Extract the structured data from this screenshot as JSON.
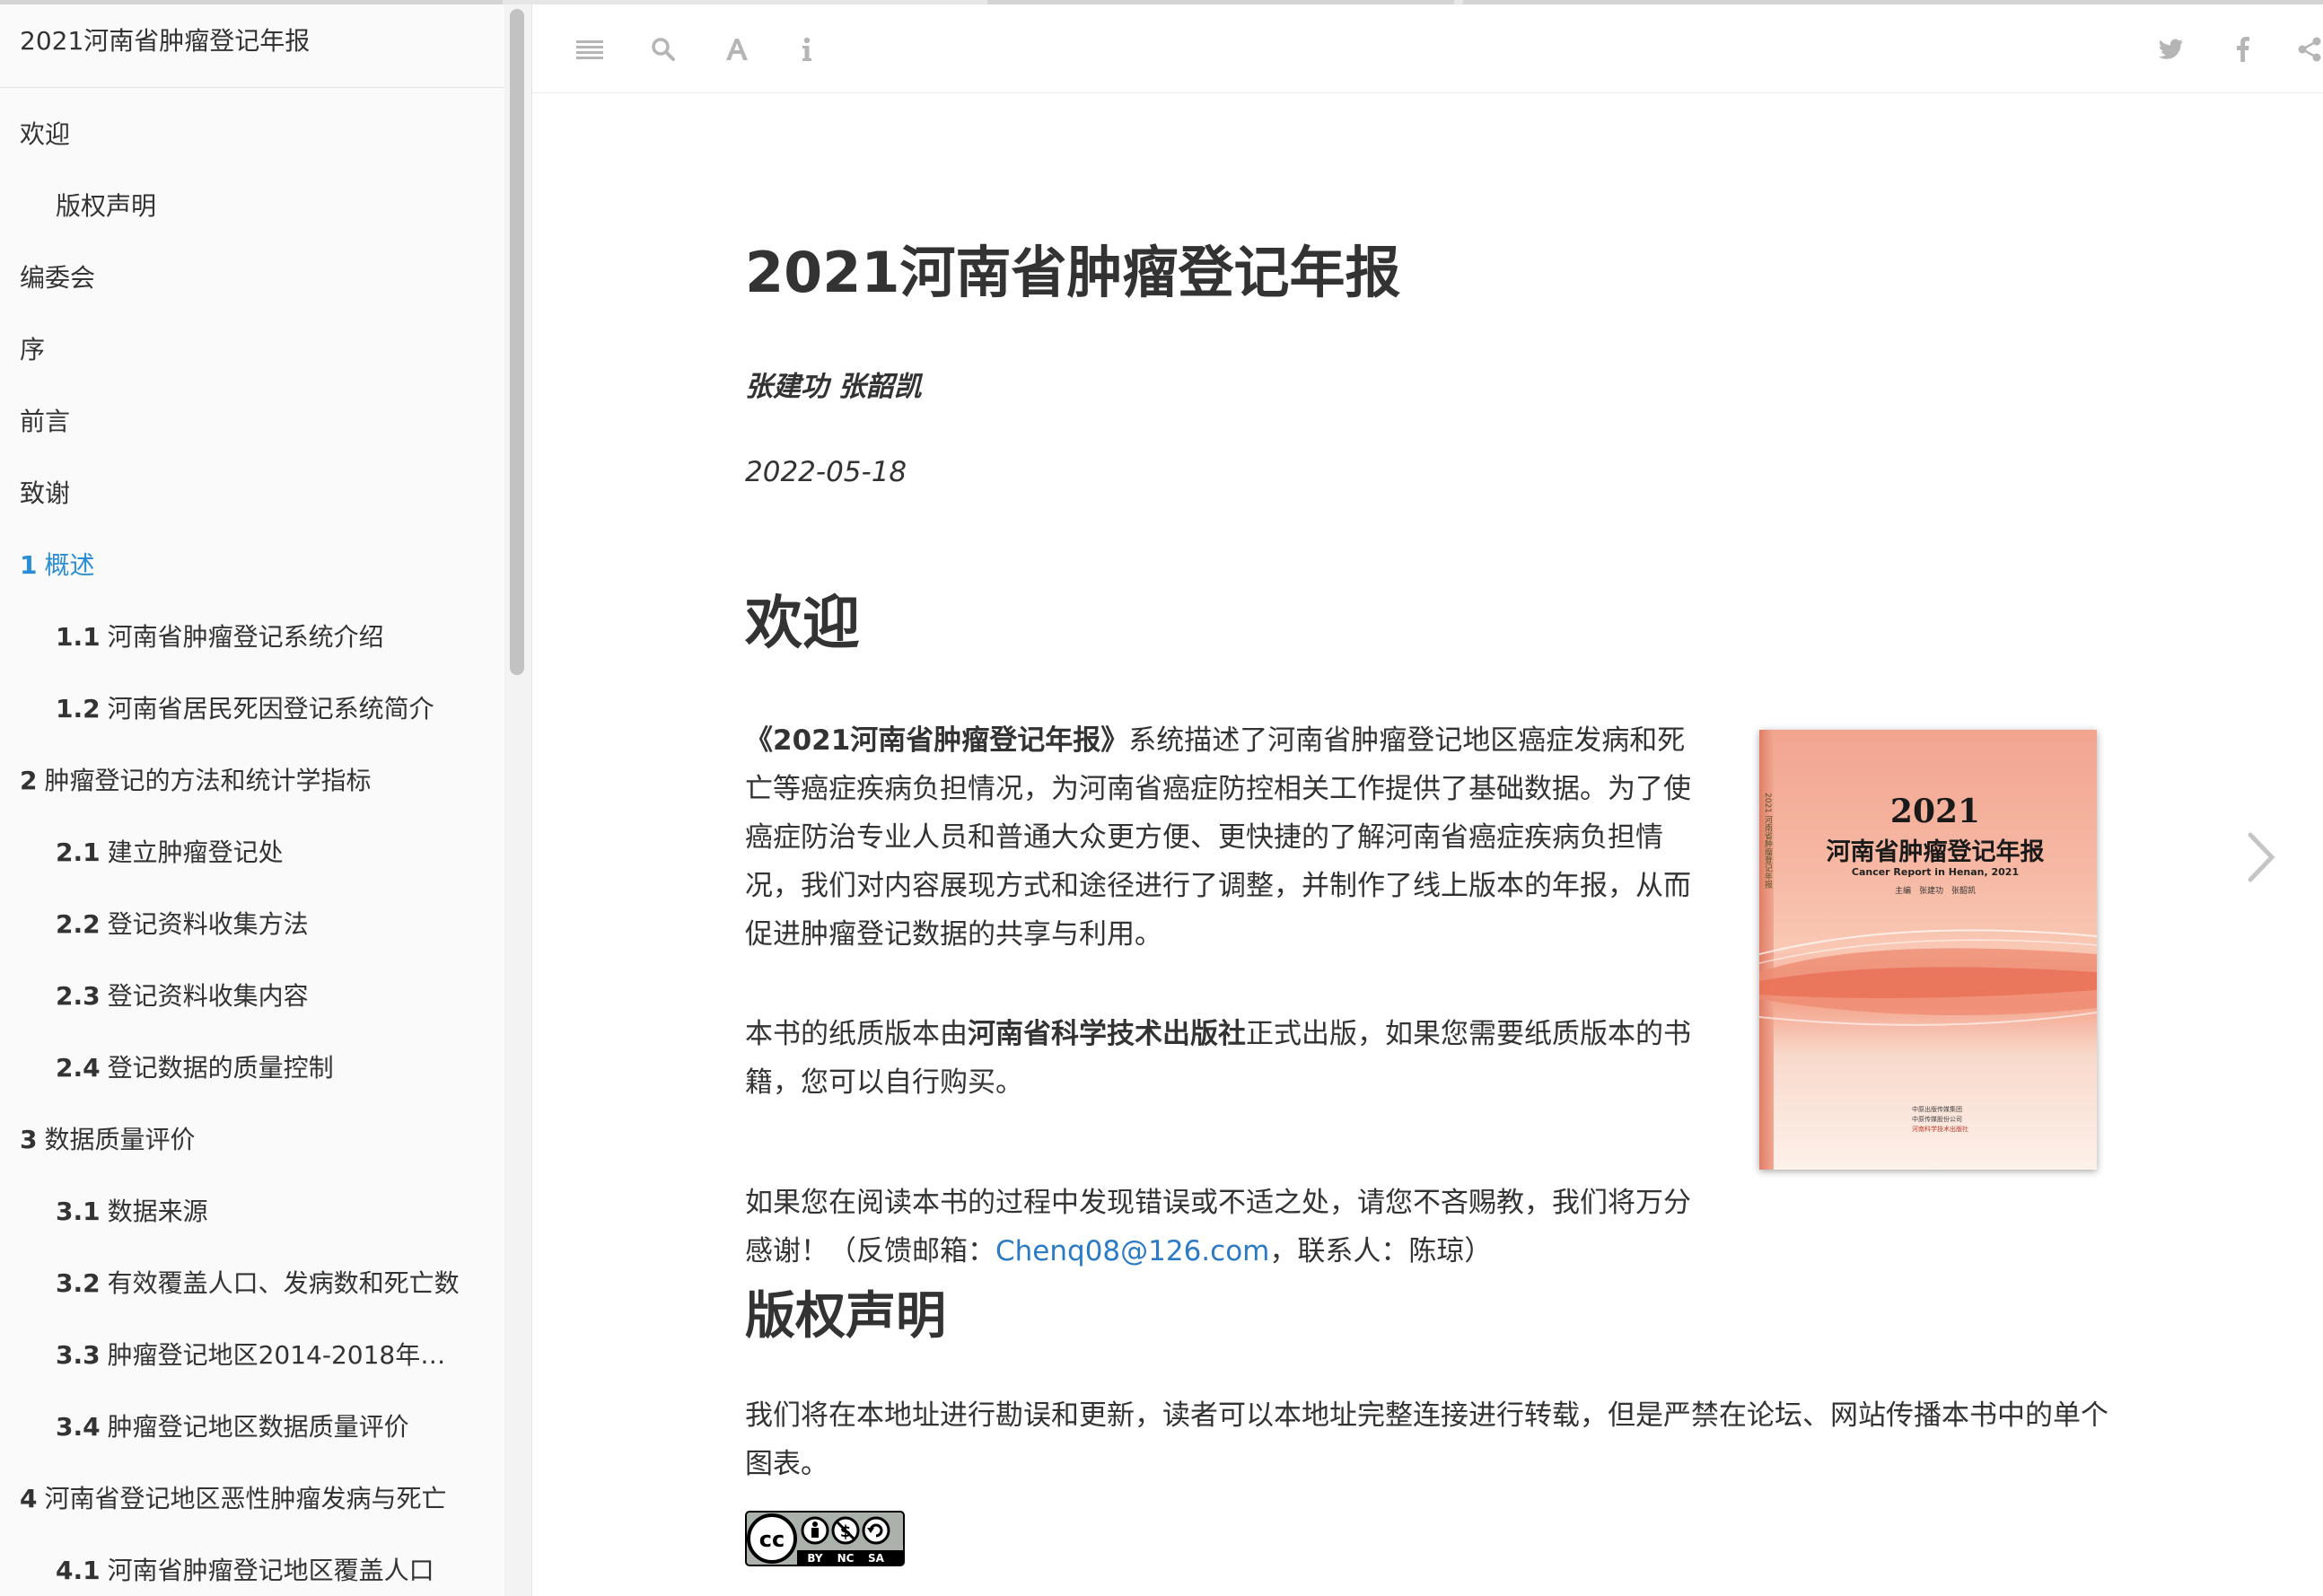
{
  "sidebar": {
    "title": "2021河南省肿瘤登记年报",
    "items": [
      {
        "num": "",
        "label": "欢迎",
        "level": 0
      },
      {
        "num": "",
        "label": "版权声明",
        "level": 1
      },
      {
        "num": "",
        "label": "编委会",
        "level": 0
      },
      {
        "num": "",
        "label": "序",
        "level": 0
      },
      {
        "num": "",
        "label": "前言",
        "level": 0
      },
      {
        "num": "",
        "label": "致谢",
        "level": 0
      },
      {
        "num": "1",
        "label": "概述",
        "level": 0,
        "active": true
      },
      {
        "num": "1.1",
        "label": "河南省肿瘤登记系统介绍",
        "level": 1
      },
      {
        "num": "1.2",
        "label": "河南省居民死因登记系统简介",
        "level": 1
      },
      {
        "num": "2",
        "label": "肿瘤登记的方法和统计学指标",
        "level": 0
      },
      {
        "num": "2.1",
        "label": "建立肿瘤登记处",
        "level": 1
      },
      {
        "num": "2.2",
        "label": "登记资料收集方法",
        "level": 1
      },
      {
        "num": "2.3",
        "label": "登记资料收集内容",
        "level": 1
      },
      {
        "num": "2.4",
        "label": "登记数据的质量控制",
        "level": 1
      },
      {
        "num": "3",
        "label": "数据质量评价",
        "level": 0
      },
      {
        "num": "3.1",
        "label": "数据来源",
        "level": 1
      },
      {
        "num": "3.2",
        "label": "有效覆盖人口、发病数和死亡数",
        "level": 1
      },
      {
        "num": "3.3",
        "label": "肿瘤登记地区2014-2018年癌…",
        "level": 1
      },
      {
        "num": "3.4",
        "label": "肿瘤登记地区数据质量评价",
        "level": 1
      },
      {
        "num": "4",
        "label": "河南省登记地区恶性肿瘤发病与死亡",
        "level": 0
      },
      {
        "num": "4.1",
        "label": "河南省肿瘤登记地区覆盖人口",
        "level": 1
      }
    ]
  },
  "toolbar": {
    "left_icons": [
      "menu-icon",
      "search-icon",
      "font-icon",
      "info-icon"
    ],
    "right_icons": [
      "twitter-icon",
      "facebook-icon",
      "share-icon"
    ]
  },
  "main": {
    "title": "2021河南省肿瘤登记年报",
    "authors": "张建功 张韶凯",
    "date": "2022-05-18",
    "welcome_heading": "欢迎",
    "p1_bold": "《2021河南省肿瘤登记年报》",
    "p1_rest": "系统描述了河南省肿瘤登记地区癌症发病和死亡等癌症疾病负担情况，为河南省癌症防控相关工作提供了基础数据。为了使癌症防治专业人员和普通大众更方便、更快捷的了解河南省癌症疾病负担情况，我们对内容展现方式和途径进行了调整，并制作了线上版本的年报，从而促进肿瘤登记数据的共享与利用。",
    "p2_pre": "本书的纸质版本由",
    "p2_bold": "河南省科学技术出版社",
    "p2_post": "正式出版，如果您需要纸质版本的书籍，您可以自行购买。",
    "p3_pre": "如果您在阅读本书的过程中发现错误或不适之处，请您不吝赐教，我们将万分感谢！（反馈邮箱：",
    "p3_email": "Chenq08@126.com",
    "p3_post": "，联系人：陈琼）",
    "copyright_heading": "版权声明",
    "p4": "我们将在本地址进行勘误和更新，读者可以本地址完整连接进行转载，但是严禁在论坛、网站传播本书中的单个图表。",
    "license_badge": {
      "cc": "cc",
      "by": "BY",
      "nc": "NC",
      "sa": "SA"
    }
  },
  "cover": {
    "year": "2021",
    "title": "河南省肿瘤登记年报",
    "subtitle": "Cancer Report in Henan, 2021",
    "authors": "主编　张建功　张韶凯",
    "publisher_lines": [
      "中原出版传媒集团",
      "中原传媒股份公司",
      "河南科学技术出版社"
    ],
    "spine": "2021 河南省肿瘤登记年报"
  },
  "colors": {
    "accent": "#2a8ed6",
    "link": "#2a7ac6",
    "text": "#333333",
    "icon_gray": "#b5b5b5"
  }
}
